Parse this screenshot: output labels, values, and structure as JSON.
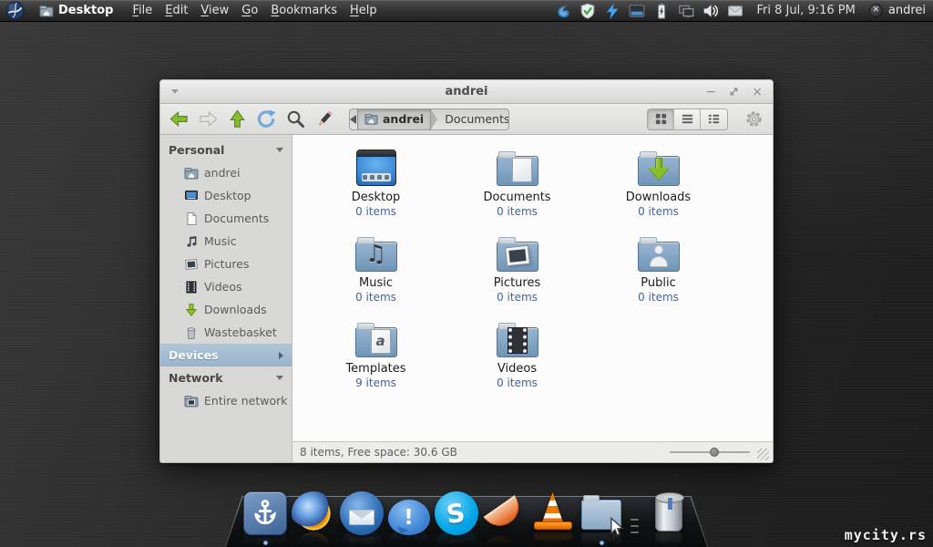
{
  "panel": {
    "app_name": "Desktop",
    "menus": [
      "File",
      "Edit",
      "View",
      "Go",
      "Bookmarks",
      "Help"
    ],
    "tray_icons": [
      "sync-swirl-icon",
      "shield-check-icon",
      "lightning-icon",
      "terminal-window-icon",
      "battery-icon",
      "displays-icon",
      "volume-icon",
      "mail-icon"
    ],
    "clock": "Fri 8 Jul, 9:16 PM",
    "user": "andrei"
  },
  "window": {
    "title": "andrei",
    "toolbar": {
      "buttons": [
        "back",
        "forward",
        "up",
        "refresh",
        "search",
        "edit-path"
      ],
      "breadcrumb": {
        "segments": [
          {
            "label": "andrei",
            "icon": "home-folder"
          },
          {
            "label": "Documents"
          }
        ]
      },
      "view_modes": [
        "icon-view",
        "list-view",
        "compact-view"
      ],
      "settings": "gear"
    },
    "sidebar": {
      "sections": [
        {
          "label": "Personal",
          "state": "expanded",
          "selected": false,
          "items": [
            {
              "label": "andrei",
              "icon": "home"
            },
            {
              "label": "Desktop",
              "icon": "desktop"
            },
            {
              "label": "Documents",
              "icon": "document"
            },
            {
              "label": "Music",
              "icon": "music"
            },
            {
              "label": "Pictures",
              "icon": "photo"
            },
            {
              "label": "Videos",
              "icon": "film"
            },
            {
              "label": "Downloads",
              "icon": "download"
            },
            {
              "label": "Wastebasket",
              "icon": "trash"
            }
          ]
        },
        {
          "label": "Devices",
          "state": "collapsed",
          "selected": true,
          "items": []
        },
        {
          "label": "Network",
          "state": "expanded",
          "selected": false,
          "items": [
            {
              "label": "Entire network",
              "icon": "network"
            }
          ]
        }
      ]
    },
    "files": [
      {
        "name": "Desktop",
        "count": "0 items",
        "icon": "desktop"
      },
      {
        "name": "Documents",
        "count": "0 items",
        "icon": "folder-documents"
      },
      {
        "name": "Downloads",
        "count": "0 items",
        "icon": "folder-downloads"
      },
      {
        "name": "Music",
        "count": "0 items",
        "icon": "folder-music"
      },
      {
        "name": "Pictures",
        "count": "0 items",
        "icon": "folder-pictures"
      },
      {
        "name": "Public",
        "count": "0 items",
        "icon": "folder-public"
      },
      {
        "name": "Templates",
        "count": "9 items",
        "icon": "folder-templates"
      },
      {
        "name": "Videos",
        "count": "0 items",
        "icon": "folder-videos"
      }
    ],
    "statusbar": {
      "text": "8 items, Free space: 30.6 GB"
    }
  },
  "dock": {
    "items": [
      {
        "name": "docky-anchor",
        "icon": "anchor",
        "running": true
      },
      {
        "name": "firefox",
        "icon": "firefox",
        "running": false
      },
      {
        "name": "thunderbird",
        "icon": "thunderbird",
        "running": false
      },
      {
        "name": "messenger",
        "icon": "chat",
        "glyph": "!",
        "running": false
      },
      {
        "name": "skype",
        "icon": "skype",
        "glyph": "S",
        "running": false
      },
      {
        "name": "clementine",
        "icon": "clementine",
        "running": false
      },
      {
        "name": "vlc",
        "icon": "vlc",
        "running": false
      },
      {
        "name": "file-manager",
        "icon": "files",
        "running": true
      },
      {
        "separator": true
      },
      {
        "name": "trash",
        "icon": "trash",
        "running": false
      }
    ]
  },
  "watermark": "mycity.rs",
  "colors": {
    "accent": "#4a90d9",
    "selection": "#98b4cc",
    "count_text": "#3f66a0",
    "folder_blue": "#7fa3c4",
    "panel_bg": "#343434"
  }
}
